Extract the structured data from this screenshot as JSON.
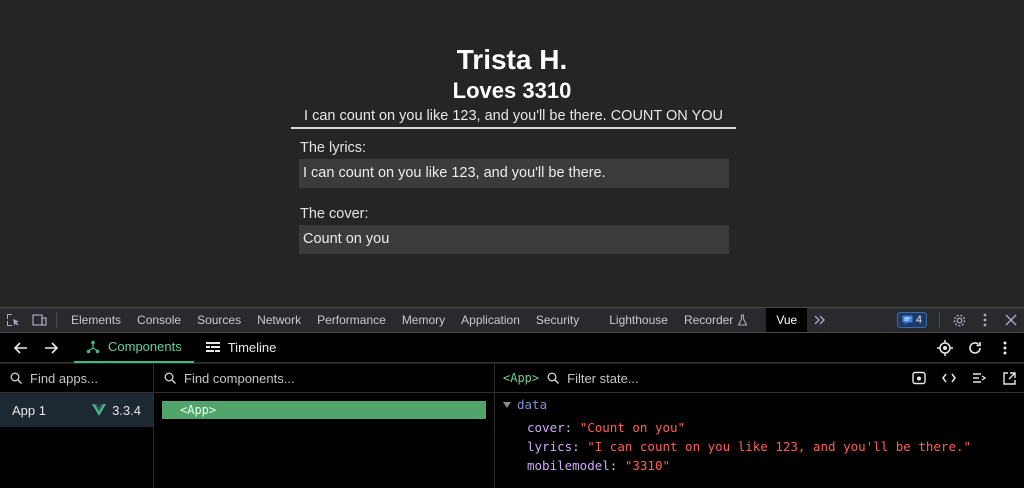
{
  "app": {
    "name": "Trista H.",
    "loves": "Loves 3310",
    "sentence": "I can count on you like 123, and you'll be there. COUNT ON YOU",
    "lyrics_label": "The lyrics:",
    "lyrics_value": "I can count on you like 123, and you'll be there.",
    "cover_label": "The cover:",
    "cover_value": "Count on you"
  },
  "devtools": {
    "tabs": [
      "Elements",
      "Console",
      "Sources",
      "Network",
      "Performance",
      "Memory",
      "Application",
      "Security",
      "Lighthouse",
      "Recorder",
      "Vue"
    ],
    "active_tab": "Vue",
    "issues_count": "4",
    "icons": [
      "inspect-icon",
      "device-toggle-icon",
      "more-tabs-icon",
      "issues-icon",
      "settings-icon",
      "kebab-menu-icon",
      "close-icon"
    ]
  },
  "vue": {
    "tabs": [
      {
        "label": "Components",
        "icon": "components-icon"
      },
      {
        "label": "Timeline",
        "icon": "timeline-icon"
      }
    ],
    "find_apps_placeholder": "Find apps...",
    "find_components_placeholder": "Find components...",
    "filter_state_placeholder": "Filter state...",
    "app_item": {
      "label": "App 1",
      "version": "3.3.4"
    },
    "component_root": "<App>",
    "selected_component": "<App>",
    "section": "data",
    "state": [
      {
        "key": "cover",
        "value": "\"Count on you\""
      },
      {
        "key": "lyrics",
        "value": "\"I can count on you like 123, and you'll be there.\""
      },
      {
        "key": "mobilemodel",
        "value": "\"3310\""
      }
    ],
    "colors": {
      "accent": "#42b883",
      "selected_row": "#51a56a",
      "string_value": "#ff5f52",
      "key": "#d0a8ff"
    }
  }
}
